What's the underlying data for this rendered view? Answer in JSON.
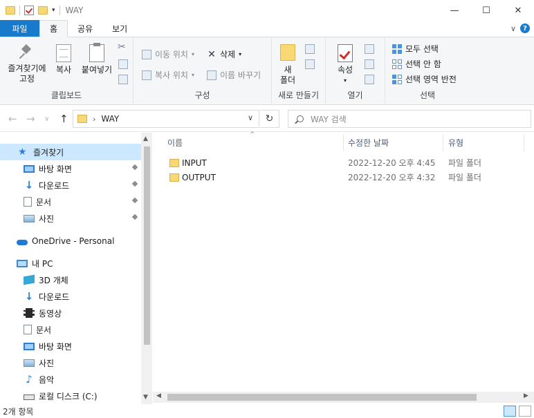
{
  "window": {
    "title": "WAY",
    "minimize_glyph": "—",
    "maximize_glyph": "☐",
    "close_glyph": "✕"
  },
  "quick_access_toolbar": {
    "dropdown_glyph": "▾"
  },
  "ribbon_tabs": {
    "file": "파일",
    "home": "홈",
    "share": "공유",
    "view": "보기",
    "expand_glyph": "∨",
    "help_glyph": "?"
  },
  "ribbon": {
    "clipboard": {
      "pin_line1": "즐겨찾기에",
      "pin_line2": "고정",
      "copy": "복사",
      "paste": "붙여넣기",
      "group_label": "클립보드"
    },
    "organize": {
      "move_to": "이동 위치",
      "copy_to": "복사 위치",
      "delete": "삭제",
      "rename": "이름 바꾸기",
      "group_label": "구성"
    },
    "new": {
      "new_folder_line1": "새",
      "new_folder_line2": "폴더",
      "group_label": "새로 만들기"
    },
    "open": {
      "properties": "속성",
      "group_label": "열기"
    },
    "select": {
      "select_all": "모두 선택",
      "select_none": "선택 안 함",
      "invert_selection": "선택 영역 반전",
      "group_label": "선택"
    }
  },
  "address_bar": {
    "path": "WAY",
    "separator": "›",
    "dropdown_glyph": "∨",
    "refresh_glyph": "↻"
  },
  "nav_buttons": {
    "back": "←",
    "forward": "→",
    "recent": "∨",
    "up": "↑"
  },
  "search": {
    "placeholder": "WAY 검색"
  },
  "nav_pane": {
    "quick_access": "즐겨찾기",
    "quick_items": [
      "바탕 화면",
      "다운로드",
      "문서",
      "사진"
    ],
    "onedrive": "OneDrive - Personal",
    "this_pc": "내 PC",
    "pc_items": [
      "3D 개체",
      "다운로드",
      "동영상",
      "문서",
      "바탕 화면",
      "사진",
      "음악",
      "로컬 디스크 (C:)"
    ]
  },
  "columns": {
    "name": "이름",
    "date_modified": "수정한 날짜",
    "type": "유형",
    "sort_glyph": "^"
  },
  "files": [
    {
      "name": "INPUT",
      "date": "2022-12-20 오후 4:45",
      "type": "파일 폴더"
    },
    {
      "name": "OUTPUT",
      "date": "2022-12-20 오후 4:32",
      "type": "파일 폴더"
    }
  ],
  "status_bar": {
    "item_count": "2개 항목"
  },
  "colors": {
    "file_tab": "#1979ca",
    "selection": "#cce8ff",
    "folder": "#f8d775"
  }
}
